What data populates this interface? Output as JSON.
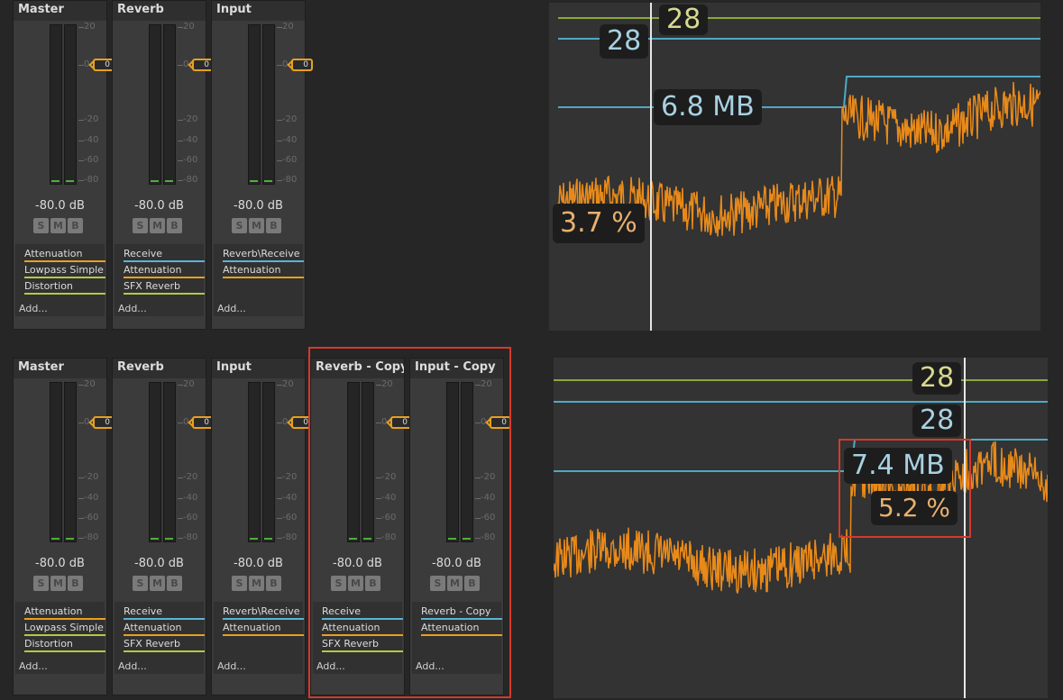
{
  "top_mixer": {
    "strips": [
      {
        "title": "Master",
        "db": "-80.0 dB",
        "fader": "0",
        "effects": [
          {
            "label": "Attenuation",
            "color": "#e8a020",
            "dot": false
          },
          {
            "label": "Lowpass Simple",
            "color": "#b7c940",
            "dot": true
          },
          {
            "label": "Distortion",
            "color": "#b7c940",
            "dot": true
          }
        ]
      },
      {
        "title": "Reverb",
        "db": "-80.0 dB",
        "fader": "0",
        "effects": [
          {
            "label": "Receive",
            "color": "#5ab4d4",
            "dot": false
          },
          {
            "label": "Attenuation",
            "color": "#e8a020",
            "dot": false
          },
          {
            "label": "SFX Reverb",
            "color": "#b7c940",
            "dot": true
          }
        ]
      },
      {
        "title": "Input",
        "db": "-80.0 dB",
        "fader": "0",
        "effects": [
          {
            "label": "Reverb\\Receive",
            "color": "#5ab4d4",
            "dot": false
          },
          {
            "label": "Attenuation",
            "color": "#e8a020",
            "dot": false
          }
        ]
      }
    ]
  },
  "bottom_mixer": {
    "strips": [
      {
        "title": "Master",
        "db": "-80.0 dB",
        "fader": "0",
        "effects": [
          {
            "label": "Attenuation",
            "color": "#e8a020",
            "dot": false
          },
          {
            "label": "Lowpass Simple",
            "color": "#b7c940",
            "dot": true
          },
          {
            "label": "Distortion",
            "color": "#b7c940",
            "dot": true
          }
        ]
      },
      {
        "title": "Reverb",
        "db": "-80.0 dB",
        "fader": "0",
        "effects": [
          {
            "label": "Receive",
            "color": "#5ab4d4",
            "dot": false
          },
          {
            "label": "Attenuation",
            "color": "#e8a020",
            "dot": false
          },
          {
            "label": "SFX Reverb",
            "color": "#b7c940",
            "dot": true
          }
        ]
      },
      {
        "title": "Input",
        "db": "-80.0 dB",
        "fader": "0",
        "effects": [
          {
            "label": "Reverb\\Receive",
            "color": "#5ab4d4",
            "dot": false
          },
          {
            "label": "Attenuation",
            "color": "#e8a020",
            "dot": false
          }
        ]
      },
      {
        "title": "Reverb - Copy",
        "db": "-80.0 dB",
        "fader": "0",
        "effects": [
          {
            "label": "Receive",
            "color": "#5ab4d4",
            "dot": false
          },
          {
            "label": "Attenuation",
            "color": "#e8a020",
            "dot": false
          },
          {
            "label": "SFX Reverb",
            "color": "#b7c940",
            "dot": true
          }
        ]
      },
      {
        "title": "Input - Copy",
        "db": "-80.0 dB",
        "fader": "0",
        "effects": [
          {
            "label": "Reverb - Copy",
            "color": "#5ab4d4",
            "dot": false
          },
          {
            "label": "Attenuation",
            "color": "#e8a020",
            "dot": false
          }
        ]
      }
    ]
  },
  "strip_common": {
    "solo": "S",
    "mute": "M",
    "bypass": "B",
    "add_label": "Add...",
    "scale": [
      "20",
      "0",
      "-20",
      "-40",
      "-60",
      "-80"
    ]
  },
  "top_graph": {
    "label_green": "28",
    "label_blue": "28",
    "label_memory": "6.8 MB",
    "label_cpu": "3.7 %"
  },
  "bottom_graph": {
    "label_green": "28",
    "label_blue": "28",
    "label_memory": "7.4 MB",
    "label_cpu": "5.2 %"
  },
  "colors": {
    "green_line": "#8aa83a",
    "blue_line": "#4fa8c4",
    "cpu_trace": "#e88a1a",
    "highlight": "#d33a2c",
    "fader": "#e8a020"
  }
}
